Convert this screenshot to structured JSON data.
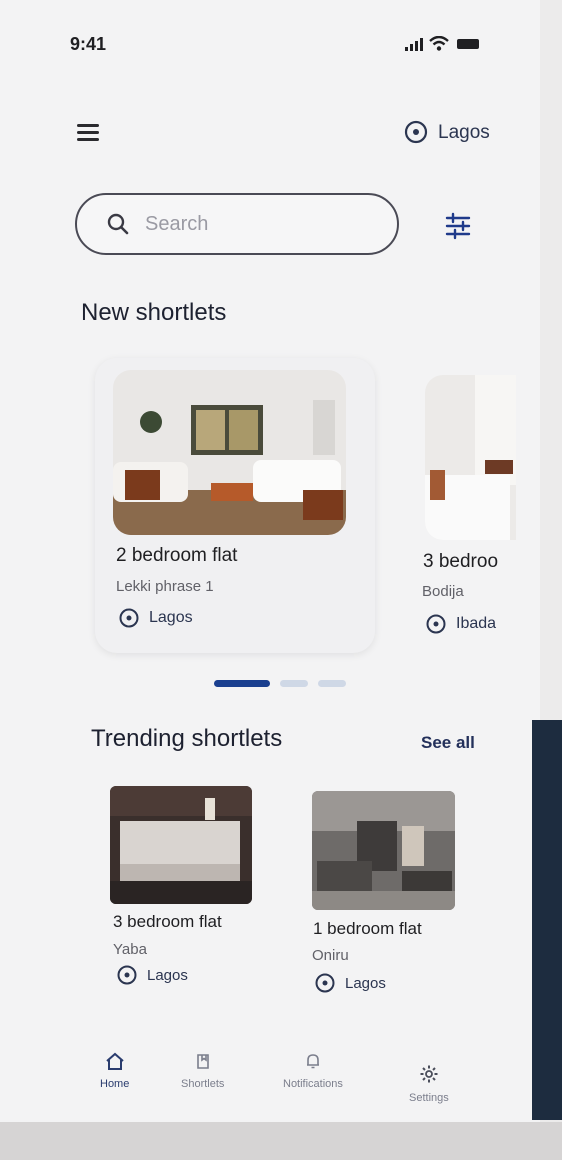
{
  "status": {
    "time": "9:41"
  },
  "header": {
    "location": "Lagos"
  },
  "search": {
    "placeholder": "Search"
  },
  "new_shortlets": {
    "title": "New shortlets",
    "cards": [
      {
        "title": "2 bedroom flat",
        "area": "Lekki phrase 1",
        "city": "Lagos"
      },
      {
        "title": "3 bedroo",
        "area": "Bodija",
        "city": "Ibada"
      }
    ]
  },
  "trending": {
    "title": "Trending shortlets",
    "see_all": "See all",
    "cards": [
      {
        "title": "3 bedroom flat",
        "area": "Yaba",
        "city": "Lagos"
      },
      {
        "title": "1 bedroom flat",
        "area": "Oniru",
        "city": "Lagos"
      }
    ]
  },
  "nav": {
    "items": [
      {
        "label": "Home",
        "icon": "home-icon"
      },
      {
        "label": "Shortlets",
        "icon": "shortlets-icon"
      },
      {
        "label": "Notifications",
        "icon": "bell-icon"
      },
      {
        "label": "Settings",
        "icon": "gear-icon"
      }
    ]
  },
  "colors": {
    "accent": "#1a3f8f",
    "text": "#1f1f22",
    "muted": "#616168"
  }
}
